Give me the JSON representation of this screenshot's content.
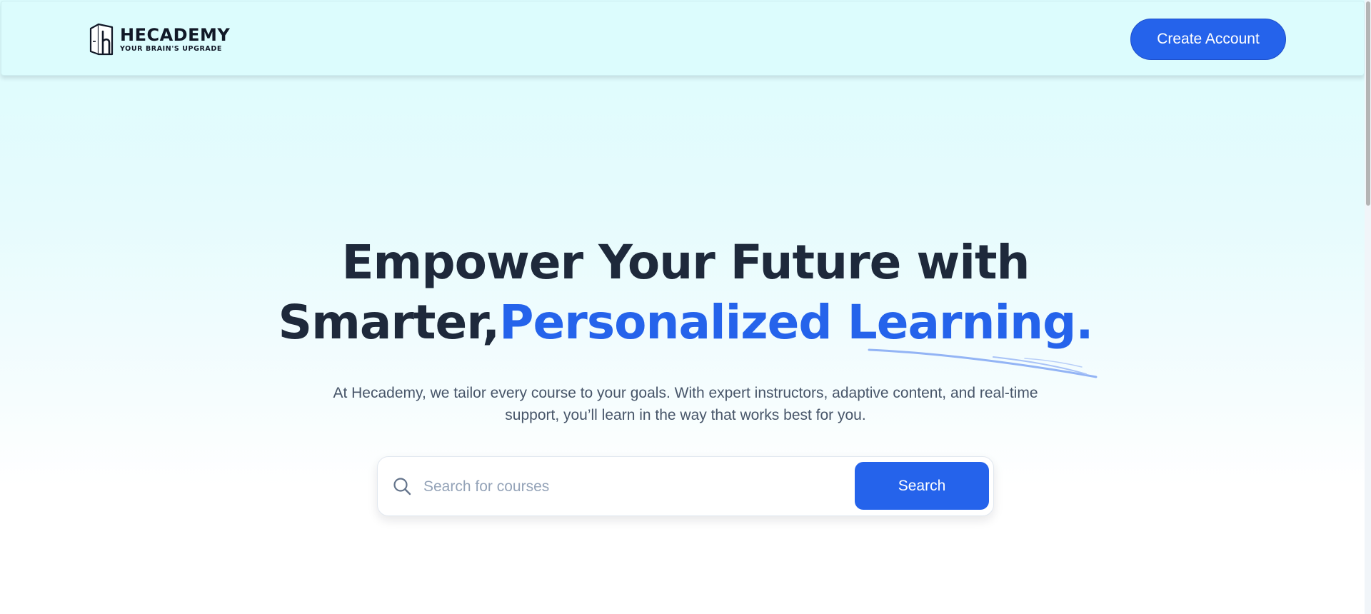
{
  "header": {
    "logo": {
      "title": "HECADEMY",
      "tagline": "YOUR BRAIN'S UPGRADE",
      "icon": "hecademy-logo-icon"
    },
    "create_account_label": "Create Account"
  },
  "hero": {
    "title_line1": "Empower Your Future with",
    "title_line2_plain": "Smarter,",
    "title_line2_accent": "Personalized Learning.",
    "subtitle": "At Hecademy, we tailor every course to your goals. With expert instructors, adaptive content, and real-time support, you’ll learn in the way that works best for you."
  },
  "search": {
    "icon": "search-icon",
    "placeholder": "Search for courses",
    "value": "",
    "button_label": "Search"
  },
  "colors": {
    "accent": "#2563eb",
    "heading": "#1e293b",
    "body_text": "#475569",
    "header_bg": "#dcfcfd"
  }
}
